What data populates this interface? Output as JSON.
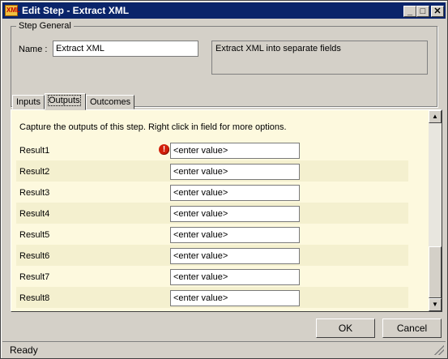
{
  "window": {
    "title": "Edit Step - Extract XML",
    "app_icon": "xml-step-icon",
    "icon_text": "XML"
  },
  "titlebar": {
    "minimize": "_",
    "maximize": "□",
    "close": "✕"
  },
  "step_general": {
    "legend": "Step General",
    "name_label": "Name :",
    "name_value": "Extract XML",
    "description": "Extract XML into separate fields"
  },
  "tabs": [
    {
      "label": "Inputs",
      "active": false
    },
    {
      "label": "Outputs",
      "active": true
    },
    {
      "label": "Outcomes",
      "active": false
    }
  ],
  "outputs": {
    "caption": "Capture the outputs of this step.  Right click in field for more options.",
    "rows": [
      {
        "label": "Result1",
        "value": "<enter value>",
        "warning": true
      },
      {
        "label": "Result2",
        "value": "<enter value>",
        "warning": false
      },
      {
        "label": "Result3",
        "value": "<enter value>",
        "warning": false
      },
      {
        "label": "Result4",
        "value": "<enter value>",
        "warning": false
      },
      {
        "label": "Result5",
        "value": "<enter value>",
        "warning": false
      },
      {
        "label": "Result6",
        "value": "<enter value>",
        "warning": false
      },
      {
        "label": "Result7",
        "value": "<enter value>",
        "warning": false
      },
      {
        "label": "Result8",
        "value": "<enter value>",
        "warning": false
      }
    ],
    "warning_glyph": "!"
  },
  "scrollbar": {
    "up": "▲",
    "down": "▼"
  },
  "buttons": {
    "ok": "OK",
    "cancel": "Cancel"
  },
  "status": {
    "text": "Ready"
  },
  "colors": {
    "title_bg": "#0a246a",
    "panel_bg": "#fdf9de",
    "row_alt": "#f4f0cf",
    "warning": "#d21f0b"
  }
}
